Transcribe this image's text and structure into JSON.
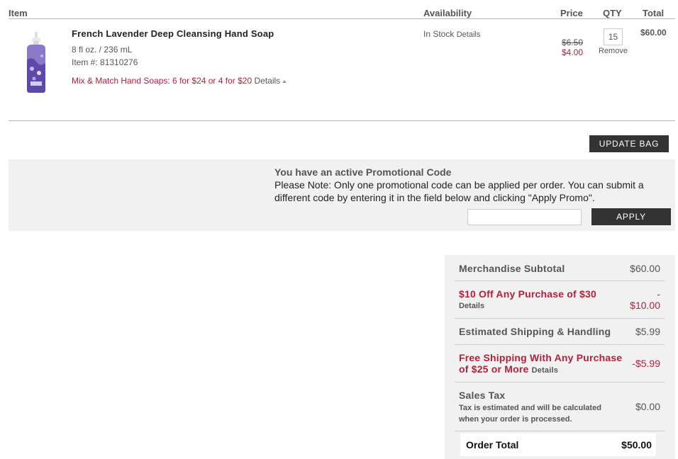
{
  "headers": {
    "item": "Item",
    "availability": "Availability",
    "price": "Price",
    "qty": "QTY",
    "total": "Total"
  },
  "product": {
    "name": "French Lavender Deep Cleansing Hand Soap",
    "size": "8 fl oz. / 236 mL",
    "item_label": "Item #: ",
    "item_number": "81310276",
    "promo": "Mix & Match Hand Soaps: 6 for $24 or 4 for $20",
    "promo_details": "Details",
    "availability": "In Stock",
    "availability_details": "Details",
    "price_original": "$6.50",
    "price_sale": "$4.00",
    "qty": "15",
    "remove": "Remove",
    "total": "$60.00"
  },
  "actions": {
    "update_bag": "UPDATE BAG"
  },
  "promo_code": {
    "title": "You have an active Promotional Code",
    "note": "Please Note: Only one promotional code can be applied per order. You can submit a different code by entering it in the field below and clicking \"Apply Promo\".",
    "input_value": "",
    "apply": "APPLY"
  },
  "summary": {
    "merch_label": "Merchandise Subtotal",
    "merch_value": "$60.00",
    "discount_label": "$10 Off Any Purchase of $30",
    "discount_details": "Details",
    "discount_value_line1": "-",
    "discount_value_line2": "$10.00",
    "shipping_label": "Estimated Shipping & Handling",
    "shipping_value": "$5.99",
    "free_ship_label_1": "Free Shipping With Any Purchase",
    "free_ship_label_2": "of $25 or More",
    "free_ship_details": "Details",
    "free_ship_value": "-$5.99",
    "tax_label": "Sales Tax",
    "tax_note": "Tax is estimated and will be calculated when your order is processed.",
    "tax_value": "$0.00",
    "order_total_label": "Order Total",
    "order_total_value": "$50.00"
  },
  "colors": {
    "accent_red": "#b41f3a",
    "button_dark": "#333333",
    "panel_bg": "#f1f1f1"
  }
}
